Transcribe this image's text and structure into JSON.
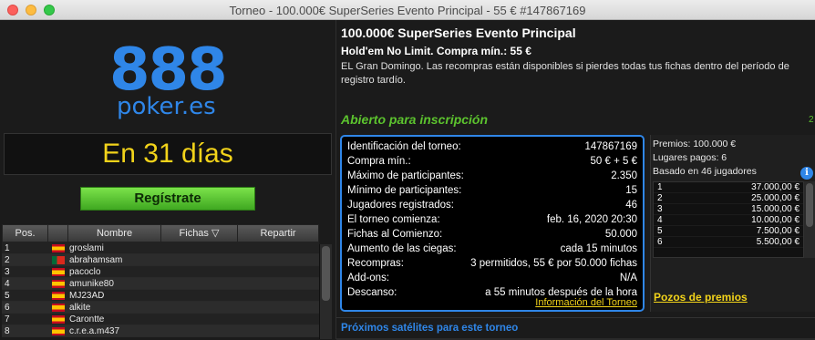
{
  "window": {
    "title": "Torneo - 100.000€ SuperSeries Evento Principal - 55 € #147867169"
  },
  "brand": {
    "logo_number": "888",
    "logo_domain": "poker.es",
    "accent": "#2f86e8"
  },
  "countdown": "En 31 días",
  "register_label": "Regístrate",
  "players_table": {
    "headers": [
      "Pos.",
      "",
      "Nombre",
      "Fichas",
      "Repartir"
    ],
    "rows": [
      {
        "pos": "1",
        "flag": "es",
        "name": "groslami"
      },
      {
        "pos": "2",
        "flag": "pt",
        "name": "abrahamsam"
      },
      {
        "pos": "3",
        "flag": "es",
        "name": "pacoclo"
      },
      {
        "pos": "4",
        "flag": "es",
        "name": "amunike80"
      },
      {
        "pos": "5",
        "flag": "es",
        "name": "MJ23AD"
      },
      {
        "pos": "6",
        "flag": "es",
        "name": "alkite"
      },
      {
        "pos": "7",
        "flag": "es",
        "name": "Carontte"
      },
      {
        "pos": "8",
        "flag": "es",
        "name": "c.r.e.a.m437"
      }
    ]
  },
  "tournament": {
    "name": "100.000€ SuperSeries Evento Principal",
    "game": "Hold'em No Limit. Compra mín.: 55 €",
    "description": "EL Gran Domingo. Las recompras están disponibles si pierdes todas tus fichas dentro del período de registro tardío.",
    "status": "Abierto para inscripción",
    "status_side": "2"
  },
  "info": [
    {
      "label": "Identificación del torneo:",
      "value": "147867169"
    },
    {
      "label": "Compra mín.:",
      "value": "50 € + 5 €"
    },
    {
      "label": "Máximo de participantes:",
      "value": "2.350"
    },
    {
      "label": "Mínimo de participantes:",
      "value": "15"
    },
    {
      "label": "Jugadores registrados:",
      "value": "46"
    },
    {
      "label": "El torneo comienza:",
      "value": "feb. 16, 2020 20:30"
    },
    {
      "label": "Fichas al Comienzo:",
      "value": "50.000"
    },
    {
      "label": "Aumento de las ciegas:",
      "value": "cada 15 minutos"
    },
    {
      "label": "Recompras:",
      "value": "3 permitidos, 55 € por 50.000 fichas"
    },
    {
      "label": "Add-ons:",
      "value": "N/A"
    },
    {
      "label": "Descanso:",
      "value": "a 55 minutos después de la hora"
    }
  ],
  "info_link": "Información del Torneo",
  "prizes": {
    "total": "Premios: 100.000 €",
    "paid": "Lugares pagos: 6",
    "based": "Basado en 46 jugadores",
    "rows": [
      {
        "place": "1",
        "amount": "37.000,00 €"
      },
      {
        "place": "2",
        "amount": "25.000,00 €"
      },
      {
        "place": "3",
        "amount": "15.000,00 €"
      },
      {
        "place": "4",
        "amount": "10.000,00 €"
      },
      {
        "place": "5",
        "amount": "7.500,00 €"
      },
      {
        "place": "6",
        "amount": "5.500,00 €"
      }
    ],
    "link": "Pozos de premios"
  },
  "satellites_label": "Próximos satélites para este torneo"
}
